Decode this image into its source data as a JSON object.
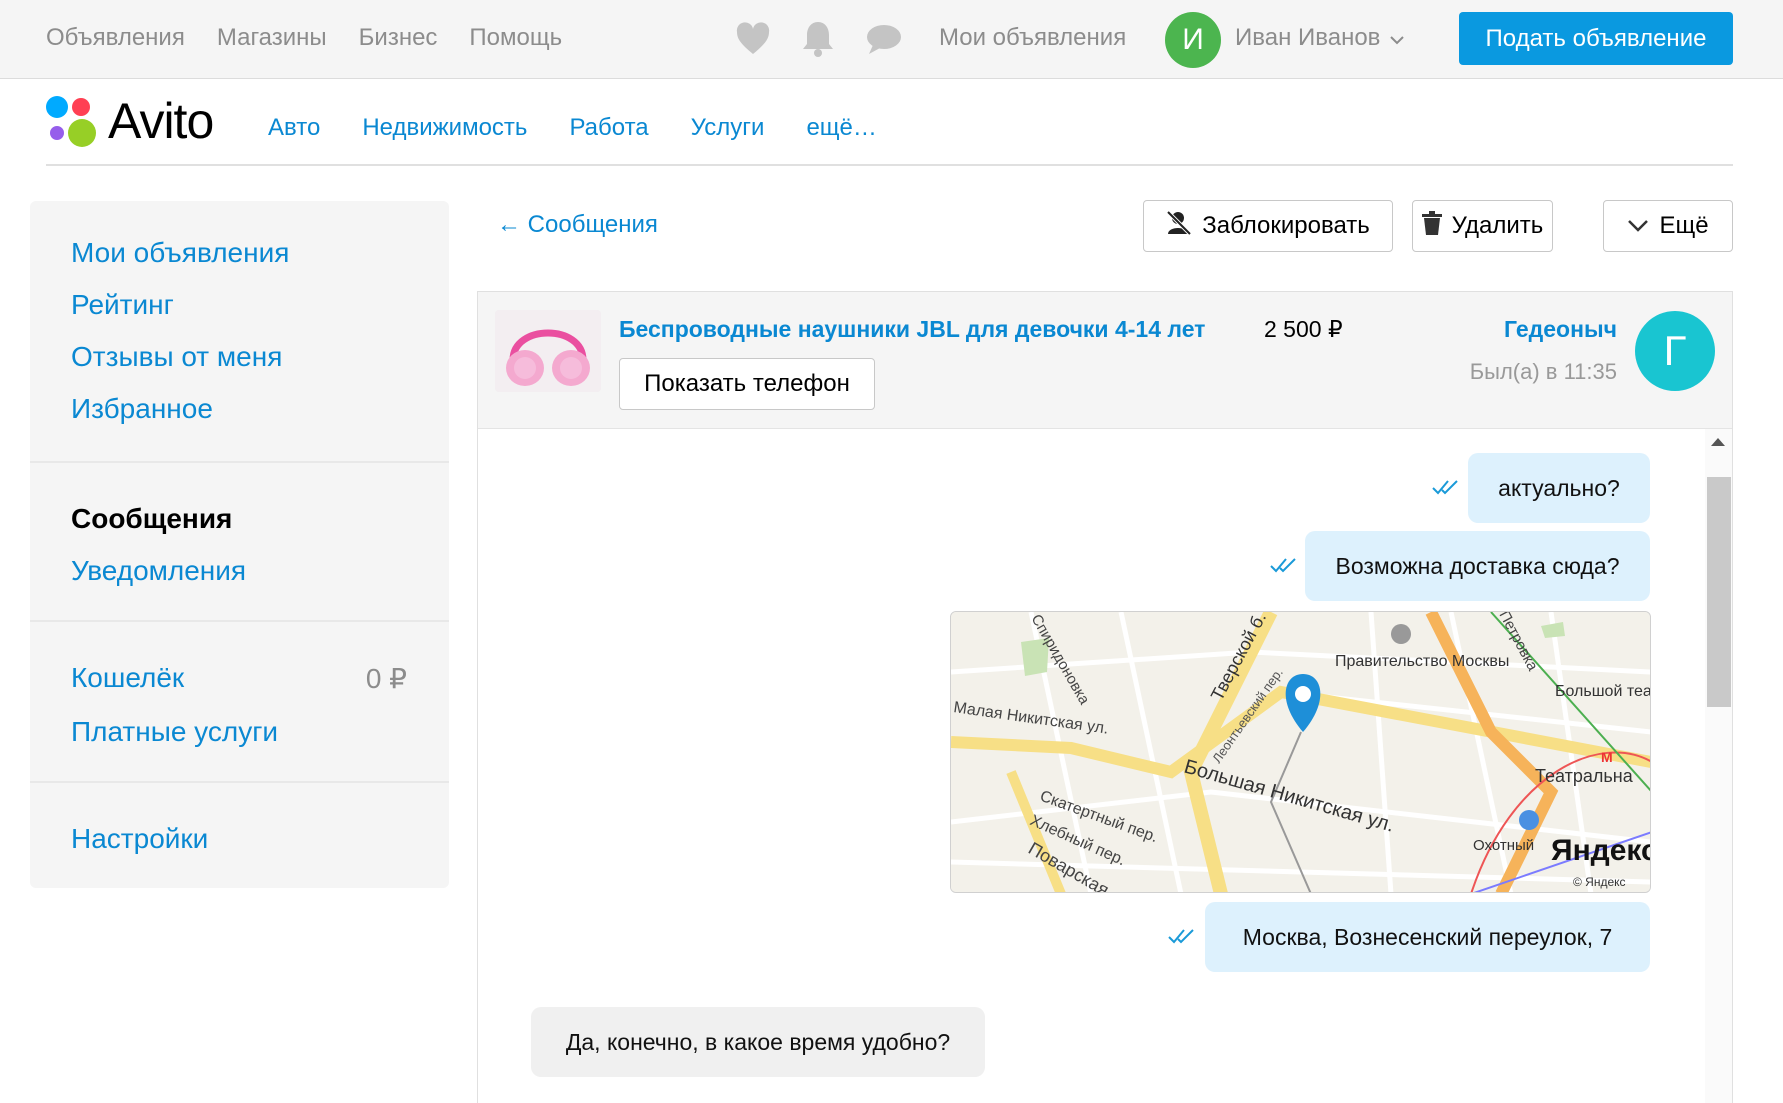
{
  "topbar": {
    "nav": [
      "Объявления",
      "Магазины",
      "Бизнес",
      "Помощь"
    ],
    "my_ads": "Мои объявления",
    "user_initial": "И",
    "user_name": "Иван Иванов",
    "post_button": "Подать объявление",
    "icons": [
      "heart-icon",
      "bell-icon",
      "chat-icon",
      "chevron-down-icon"
    ]
  },
  "header": {
    "logo_text": "Avito",
    "categories": [
      "Авто",
      "Недвижимость",
      "Работа",
      "Услуги",
      "ещё…"
    ]
  },
  "sidebar": {
    "group1": [
      "Мои объявления",
      "Рейтинг",
      "Отзывы от меня",
      "Избранное"
    ],
    "group2": [
      "Сообщения",
      "Уведомления"
    ],
    "wallet_label": "Кошелёк",
    "wallet_value": "0 ₽",
    "paid_services": "Платные услуги",
    "settings": "Настройки"
  },
  "messages": {
    "back_link": "← Сообщения",
    "block_button": "Заблокировать",
    "delete_button": "Удалить",
    "more_button": "Ещё"
  },
  "chat": {
    "ad_title": "Беспроводные наушники JBL для девочки 4-14 лет",
    "ad_price": "2 500 ₽",
    "show_phone": "Показать телефон",
    "seller_name": "Гедеоныч",
    "seller_last_seen": "Был(а) в 11:35",
    "seller_initial": "Г",
    "messages": [
      {
        "direction": "out",
        "text": "актуально?",
        "status": "read"
      },
      {
        "direction": "out",
        "text": "Возможна доставка сюда?",
        "status": "read"
      },
      {
        "direction": "out",
        "type": "map",
        "status": "read"
      },
      {
        "direction": "out",
        "text": "Москва, Вознесенский переулок, 7",
        "status": "read"
      },
      {
        "direction": "in",
        "text": "Да, конечно, в какое время удобно?"
      }
    ],
    "map_labels": {
      "street1": "Большая Никитская ул.",
      "street2": "Малая Никитская ул.",
      "street3": "Тверской б.",
      "street4": "Леонтьевский пер.",
      "street5": "Скатертный пер.",
      "street6": "Хлебный пер.",
      "street7": "Поварская",
      "street8": "Спиридоновка",
      "street9": "Петровка",
      "poi1": "Правительство Москвы",
      "poi2": "Большой театр",
      "poi3": "Театральна",
      "poi4": "Охотный",
      "brand": "Яндекс",
      "copyright": "© Яндекс"
    }
  },
  "colors": {
    "accent": "#0a88d2",
    "button_blue": "#0a99e0",
    "user_avatar": "#4cb54f",
    "seller_avatar": "#19c5d1",
    "out_bubble": "#ddf1fd",
    "in_bubble": "#f0f0f0"
  }
}
